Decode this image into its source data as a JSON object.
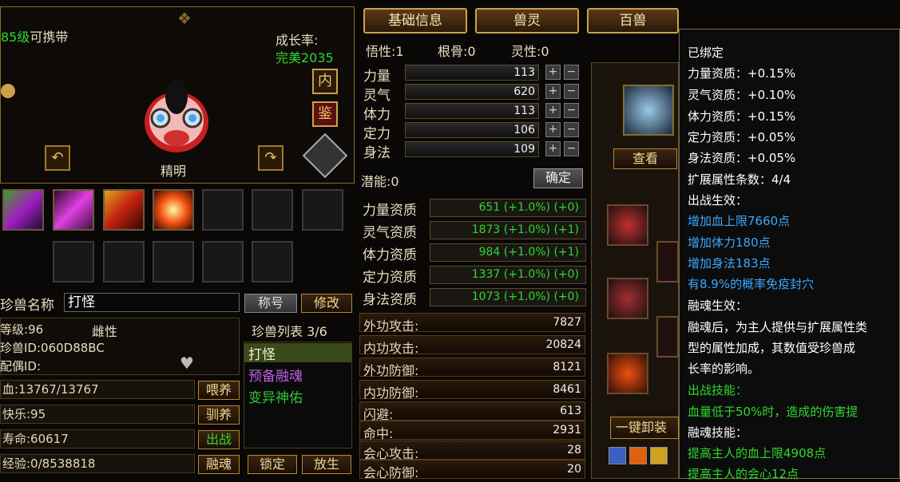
{
  "pet": {
    "level_text": "85级",
    "carry_text": "可携带",
    "growth_label": "成长率:",
    "growth_value": "完美2035",
    "nickname_caption": "精明",
    "btn_inner": "内",
    "btn_appraise": "鉴",
    "name_label": "珍兽名称",
    "name_value": "打怪",
    "title_button": "称号",
    "modify_button": "修改",
    "level_row": "等级:96",
    "gender": "雌性",
    "pet_id": "珍兽ID:060D88BC",
    "mate": "配偶ID:",
    "hp": "血:13767/13767",
    "happiness": "快乐:95",
    "lifespan": "寿命:60617",
    "exp": "经验:0/8538818",
    "feed_button": "喂养",
    "tame_button": "驯养",
    "fight_button": "出战",
    "fuse_button": "融魂",
    "lock_button": "锁定",
    "release_button": "放生",
    "list_title": "珍兽列表 3/6",
    "list": [
      "打怪",
      "预备融魂",
      "变异神佑"
    ]
  },
  "tabs": [
    "基础信息",
    "兽灵",
    "百兽"
  ],
  "base": {
    "wuxing": "悟性:1",
    "gengu": "根骨:0",
    "lingxing": "灵性:0",
    "stats": [
      {
        "label": "力量",
        "value": "113"
      },
      {
        "label": "灵气",
        "value": "620"
      },
      {
        "label": "体力",
        "value": "113"
      },
      {
        "label": "定力",
        "value": "106"
      },
      {
        "label": "身法",
        "value": "109"
      }
    ],
    "potential": "潜能:0",
    "confirm": "确定",
    "aptitudes": [
      {
        "label": "力量资质",
        "value": "651 (+1.0%) (+0)"
      },
      {
        "label": "灵气资质",
        "value": "1873 (+1.0%) (+1)"
      },
      {
        "label": "体力资质",
        "value": "984 (+1.0%) (+1)"
      },
      {
        "label": "定力资质",
        "value": "1337 (+1.0%) (+0)"
      },
      {
        "label": "身法资质",
        "value": "1073 (+1.0%) (+0)"
      }
    ],
    "attrs": [
      {
        "label": "外功攻击:",
        "value": "7827"
      },
      {
        "label": "内功攻击:",
        "value": "20824"
      },
      {
        "label": "外功防御:",
        "value": "8121"
      },
      {
        "label": "内功防御:",
        "value": "8461"
      },
      {
        "label": "闪避:",
        "value": "613"
      },
      {
        "label": "命中:",
        "value": "2931"
      },
      {
        "label": "会心攻击:",
        "value": "28"
      },
      {
        "label": "会心防御:",
        "value": "20"
      }
    ]
  },
  "spirit": {
    "view_button": "查看",
    "unload_button": "一键卸装"
  },
  "tooltip": {
    "bound": "已绑定",
    "lines": [
      "力量资质：+0.15%",
      "灵气资质：+0.10%",
      "体力资质：+0.15%",
      "定力资质：+0.05%",
      "身法资质：+0.05%",
      "扩展属性条数：4/4",
      "出战生效："
    ],
    "blue_lines": [
      "增加血上限7660点",
      "增加体力180点",
      "增加身法183点",
      "有8.9%的概率免疫封穴"
    ],
    "fuse_title": "融魂生效：",
    "fuse_desc": [
      "融魂后，为主人提供与扩展属性类",
      "型的属性加成，其数值受珍兽成",
      "长率的影响。"
    ],
    "skill_title": "出战技能：",
    "skill_line": "血量低于50%时，造成的伤害提",
    "fuse_skill_title": "融魂技能：",
    "fuse_skill_lines": [
      "提高主人的血上限4908点",
      "提高主人的会心12点"
    ]
  },
  "colors": {
    "green": "#2fd82f",
    "blue": "#3aa8ff",
    "gold": "#c9a14a"
  }
}
